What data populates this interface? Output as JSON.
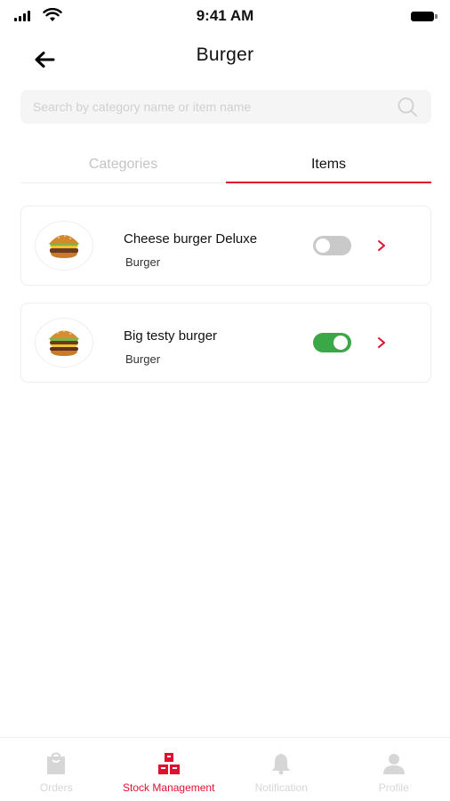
{
  "status_bar": {
    "time": "9:41 AM"
  },
  "header": {
    "title": "Burger"
  },
  "search": {
    "placeholder": "Search by category name or item name"
  },
  "tabs": [
    {
      "label": "Categories",
      "active": false
    },
    {
      "label": "Items",
      "active": true
    }
  ],
  "items": [
    {
      "name": "Cheese burger Deluxe",
      "category": "Burger",
      "enabled": false,
      "image_icon": "burger-image"
    },
    {
      "name": "Big testy burger",
      "category": "Burger",
      "enabled": true,
      "image_icon": "burger-image"
    }
  ],
  "bottom_nav": [
    {
      "label": "Orders",
      "icon": "orders-icon",
      "active": false
    },
    {
      "label": "Stock Management",
      "icon": "stock-management-icon",
      "active": true
    },
    {
      "label": "Notification",
      "icon": "bell-icon",
      "active": false
    },
    {
      "label": "Profile",
      "icon": "profile-icon",
      "active": false
    }
  ],
  "colors": {
    "accent": "#e0102f",
    "toggle_on": "#3aa846",
    "toggle_off": "#c9c9c9"
  }
}
